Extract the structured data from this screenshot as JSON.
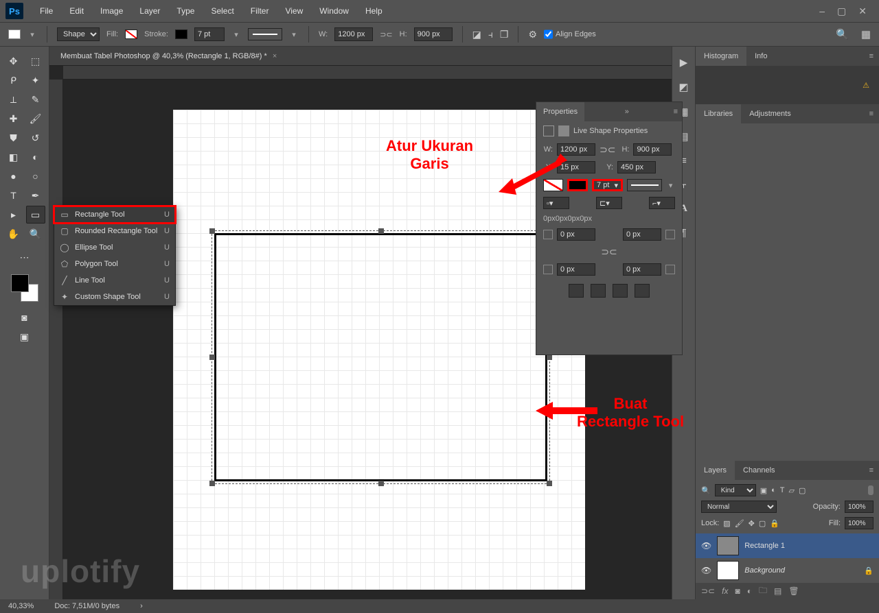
{
  "menu": {
    "items": [
      "File",
      "Edit",
      "Image",
      "Layer",
      "Type",
      "Select",
      "Filter",
      "View",
      "Window",
      "Help"
    ]
  },
  "optionsBar": {
    "shapeMode": "Shape",
    "fillLabel": "Fill:",
    "strokeLabel": "Stroke:",
    "strokeWidth": "7 pt",
    "wLabel": "W:",
    "wValue": "1200 px",
    "hLabel": "H:",
    "hValue": "900 px",
    "alignEdges": "Align Edges"
  },
  "document": {
    "tabTitle": "Membuat Tabel Photoshop @ 40,3% (Rectangle 1, RGB/8#) *"
  },
  "toolPopup": {
    "items": [
      {
        "label": "Rectangle Tool",
        "key": "U",
        "selected": true
      },
      {
        "label": "Rounded Rectangle Tool",
        "key": "U",
        "selected": false
      },
      {
        "label": "Ellipse Tool",
        "key": "U",
        "selected": false
      },
      {
        "label": "Polygon Tool",
        "key": "U",
        "selected": false
      },
      {
        "label": "Line Tool",
        "key": "U",
        "selected": false
      },
      {
        "label": "Custom Shape Tool",
        "key": "U",
        "selected": false
      }
    ]
  },
  "properties": {
    "panel": "Properties",
    "title": "Live Shape Properties",
    "w": "1200 px",
    "h": "900 px",
    "xLabel": "X:",
    "x": "15 px",
    "yLabel": "Y:",
    "y": "450 px",
    "strokeWidth": "7 pt",
    "boundingBox": "0px0px0px0px",
    "r1": "0 px",
    "r2": "0 px",
    "r3": "0 px",
    "r4": "0 px"
  },
  "panels": {
    "histogram": "Histogram",
    "info": "Info",
    "libraries": "Libraries",
    "adjustments": "Adjustments",
    "layers": "Layers",
    "channels": "Channels"
  },
  "layers": {
    "filterLabel": "Kind",
    "blend": "Normal",
    "opacityLabel": "Opacity:",
    "opacity": "100%",
    "lockLabel": "Lock:",
    "fillLabel": "Fill:",
    "fill": "100%",
    "items": [
      {
        "name": "Rectangle 1",
        "locked": false,
        "selected": true
      },
      {
        "name": "Background",
        "locked": true,
        "selected": false
      }
    ]
  },
  "status": {
    "zoom": "40,33%",
    "doc": "Doc: 7,51M/0 bytes"
  },
  "annotations": {
    "a1": "Atur Ukuran\nGaris",
    "a2": "Buat\nRectangle Tool"
  },
  "watermark": "uplotify"
}
